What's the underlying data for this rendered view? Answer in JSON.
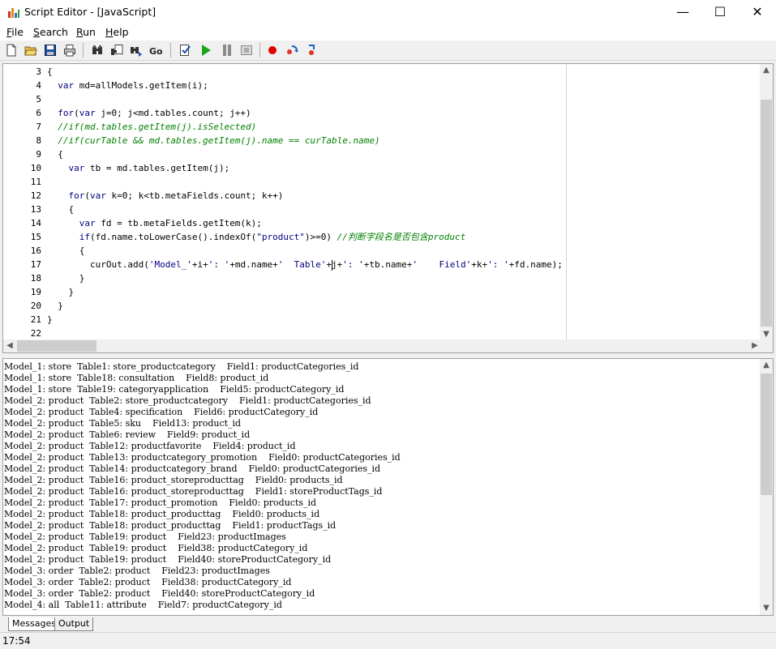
{
  "window": {
    "title": "Script Editor - [JavaScript]",
    "minimize_glyph": "—",
    "maximize_glyph": "☐",
    "close_glyph": "✕"
  },
  "menu": {
    "file": {
      "accel": "F",
      "rest": "ile"
    },
    "search": {
      "accel": "S",
      "rest": "earch"
    },
    "run": {
      "accel": "R",
      "rest": "un"
    },
    "help": {
      "accel": "H",
      "rest": "elp"
    }
  },
  "toolbar": {
    "icons": [
      "new-file-icon",
      "open-folder-icon",
      "save-icon",
      "print-icon",
      "find-icon",
      "find-replace-icon",
      "find-next-icon",
      "goto-icon",
      "check-script-icon",
      "run-icon",
      "pause-icon",
      "stop-icon",
      "breakpoint-icon",
      "step-into-icon",
      "step-over-icon"
    ],
    "colors": {
      "run": "#1ea51e",
      "breakpoint": "#e00000",
      "pause": "#8a8a8a"
    }
  },
  "editor": {
    "lines": [
      {
        "n": "3",
        "segs": [
          {
            "t": "{",
            "c": ""
          }
        ]
      },
      {
        "n": "4",
        "segs": [
          {
            "t": "  ",
            "c": ""
          },
          {
            "t": "var",
            "c": "kw"
          },
          {
            "t": " md=allModels.getItem(i);",
            "c": ""
          }
        ]
      },
      {
        "n": "5",
        "segs": []
      },
      {
        "n": "6",
        "segs": [
          {
            "t": "  ",
            "c": ""
          },
          {
            "t": "for",
            "c": "kw"
          },
          {
            "t": "(",
            "c": ""
          },
          {
            "t": "var",
            "c": "kw"
          },
          {
            "t": " j=0; j<md.tables.count; j++)",
            "c": ""
          }
        ]
      },
      {
        "n": "7",
        "segs": [
          {
            "t": "  ",
            "c": ""
          },
          {
            "t": "//if(md.tables.getItem(j).isSelected)",
            "c": "cm"
          }
        ]
      },
      {
        "n": "8",
        "segs": [
          {
            "t": "  ",
            "c": ""
          },
          {
            "t": "//if(curTable && md.tables.getItem(j).name == curTable.name)",
            "c": "cm"
          }
        ]
      },
      {
        "n": "9",
        "segs": [
          {
            "t": "  {",
            "c": ""
          }
        ]
      },
      {
        "n": "10",
        "segs": [
          {
            "t": "    ",
            "c": ""
          },
          {
            "t": "var",
            "c": "kw"
          },
          {
            "t": " tb = md.tables.getItem(j);",
            "c": ""
          }
        ]
      },
      {
        "n": "11",
        "segs": []
      },
      {
        "n": "12",
        "segs": [
          {
            "t": "    ",
            "c": ""
          },
          {
            "t": "for",
            "c": "kw"
          },
          {
            "t": "(",
            "c": ""
          },
          {
            "t": "var",
            "c": "kw"
          },
          {
            "t": " k=0; k<tb.metaFields.count; k++)",
            "c": ""
          }
        ]
      },
      {
        "n": "13",
        "segs": [
          {
            "t": "    {",
            "c": ""
          }
        ]
      },
      {
        "n": "14",
        "segs": [
          {
            "t": "      ",
            "c": ""
          },
          {
            "t": "var",
            "c": "kw"
          },
          {
            "t": " fd = tb.metaFields.getItem(k);",
            "c": ""
          }
        ]
      },
      {
        "n": "15",
        "segs": [
          {
            "t": "      ",
            "c": ""
          },
          {
            "t": "if",
            "c": "kw"
          },
          {
            "t": "(fd.name.toLowerCase().indexOf(",
            "c": ""
          },
          {
            "t": "\"product\"",
            "c": "st"
          },
          {
            "t": ")>=0) ",
            "c": ""
          },
          {
            "t": "//判断字段名是否包含product",
            "c": "cm"
          }
        ]
      },
      {
        "n": "16",
        "segs": [
          {
            "t": "      {",
            "c": ""
          }
        ]
      },
      {
        "n": "17",
        "segs": [
          {
            "t": "        curOut.add(",
            "c": ""
          },
          {
            "t": "'Model_'",
            "c": "st"
          },
          {
            "t": "+i+",
            "c": ""
          },
          {
            "t": "': '",
            "c": "st"
          },
          {
            "t": "+md.name+",
            "c": ""
          },
          {
            "t": "'  Table'",
            "c": "st"
          },
          {
            "t": "+",
            "c": ""
          },
          {
            "t": "CARET",
            "c": "caret"
          },
          {
            "t": "j+",
            "c": ""
          },
          {
            "t": "': '",
            "c": "st"
          },
          {
            "t": "+tb.name+",
            "c": ""
          },
          {
            "t": "'    Field'",
            "c": "st"
          },
          {
            "t": "+k+",
            "c": ""
          },
          {
            "t": "': '",
            "c": "st"
          },
          {
            "t": "+fd.name);",
            "c": ""
          }
        ]
      },
      {
        "n": "18",
        "segs": [
          {
            "t": "      }",
            "c": ""
          }
        ]
      },
      {
        "n": "19",
        "segs": [
          {
            "t": "    }",
            "c": ""
          }
        ]
      },
      {
        "n": "20",
        "segs": [
          {
            "t": "  }",
            "c": ""
          }
        ]
      },
      {
        "n": "21",
        "segs": [
          {
            "t": "}",
            "c": ""
          }
        ]
      },
      {
        "n": "22",
        "segs": []
      }
    ]
  },
  "output": {
    "lines": [
      "Model_1: store  Table1: store_productcategory    Field1: productCategories_id",
      "Model_1: store  Table18: consultation    Field8: product_id",
      "Model_1: store  Table19: categoryapplication    Field5: productCategory_id",
      "Model_2: product  Table2: store_productcategory    Field1: productCategories_id",
      "Model_2: product  Table4: specification    Field6: productCategory_id",
      "Model_2: product  Table5: sku    Field13: product_id",
      "Model_2: product  Table6: review    Field9: product_id",
      "Model_2: product  Table12: productfavorite    Field4: product_id",
      "Model_2: product  Table13: productcategory_promotion    Field0: productCategories_id",
      "Model_2: product  Table14: productcategory_brand    Field0: productCategories_id",
      "Model_2: product  Table16: product_storeproducttag    Field0: products_id",
      "Model_2: product  Table16: product_storeproducttag    Field1: storeProductTags_id",
      "Model_2: product  Table17: product_promotion    Field0: products_id",
      "Model_2: product  Table18: product_producttag    Field0: products_id",
      "Model_2: product  Table18: product_producttag    Field1: productTags_id",
      "Model_2: product  Table19: product    Field23: productImages",
      "Model_2: product  Table19: product    Field38: productCategory_id",
      "Model_2: product  Table19: product    Field40: storeProductCategory_id",
      "Model_3: order  Table2: product    Field23: productImages",
      "Model_3: order  Table2: product    Field38: productCategory_id",
      "Model_3: order  Table2: product    Field40: storeProductCategory_id",
      "Model_4: all  Table11: attribute    Field7: productCategory_id"
    ]
  },
  "tabs": {
    "messages": "Messages",
    "output": "Output"
  },
  "status": {
    "position": "17:54"
  }
}
